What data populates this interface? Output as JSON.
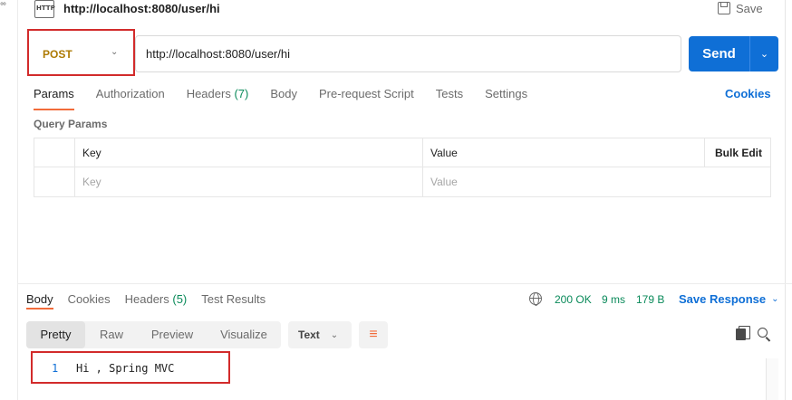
{
  "request": {
    "title": "http://localhost:8080/user/hi",
    "save_label": "Save",
    "method": "POST",
    "url": "http://localhost:8080/user/hi",
    "send_label": "Send"
  },
  "request_tabs": [
    {
      "label": "Params",
      "active": true
    },
    {
      "label": "Authorization"
    },
    {
      "label": "Headers",
      "count": "(7)"
    },
    {
      "label": "Body"
    },
    {
      "label": "Pre-request Script"
    },
    {
      "label": "Tests"
    },
    {
      "label": "Settings"
    }
  ],
  "cookies_label": "Cookies",
  "query_params": {
    "title": "Query Params",
    "headers": {
      "key": "Key",
      "value": "Value",
      "bulk_edit": "Bulk Edit"
    },
    "placeholders": {
      "key": "Key",
      "value": "Value"
    }
  },
  "response_tabs": [
    {
      "label": "Body",
      "active": true
    },
    {
      "label": "Cookies"
    },
    {
      "label": "Headers",
      "count": "(5)"
    },
    {
      "label": "Test Results"
    }
  ],
  "response_meta": {
    "status": "200 OK",
    "time": "9 ms",
    "size": "179 B",
    "save_response": "Save Response"
  },
  "view_modes": [
    "Pretty",
    "Raw",
    "Preview",
    "Visualize"
  ],
  "format": "Text",
  "response_body": [
    {
      "line": "1",
      "text": "Hi , Spring MVC"
    }
  ],
  "icons": {
    "http": "HTTP",
    "chevron": "⌄"
  },
  "colors": {
    "accent": "#0f6fd6",
    "method": "#ad7a03",
    "status": "#0a8a5a",
    "active_tab": "#f26b3a",
    "highlight_box": "#d22b2b"
  }
}
